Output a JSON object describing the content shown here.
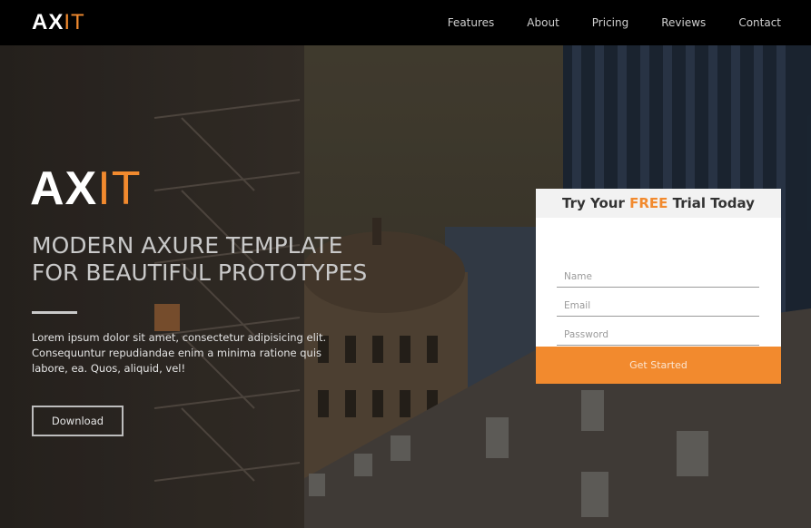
{
  "brand": {
    "logo_primary": "AX",
    "logo_accent": "IT",
    "accent_color": "#f28a2e"
  },
  "nav": {
    "items": [
      {
        "label": "Features"
      },
      {
        "label": "About"
      },
      {
        "label": "Pricing"
      },
      {
        "label": "Reviews"
      },
      {
        "label": "Contact"
      }
    ]
  },
  "hero": {
    "logo_primary": "AX",
    "logo_accent": "IT",
    "title_line1": "MODERN AXURE TEMPLATE",
    "title_line2": "FOR BEAUTIFUL PROTOTYPES",
    "description": "Lorem ipsum dolor sit amet, consectetur adipisicing elit. Consequuntur repudiandae enim a minima ratione quis labore, ea. Quos, aliquid, vel!",
    "download_label": "Download"
  },
  "trial_form": {
    "title_prefix": "Try Your ",
    "title_highlight": "FREE",
    "title_suffix": " Trial Today",
    "name_placeholder": "Name",
    "email_placeholder": "Email",
    "password_placeholder": "Password",
    "submit_label": "Get Started"
  }
}
